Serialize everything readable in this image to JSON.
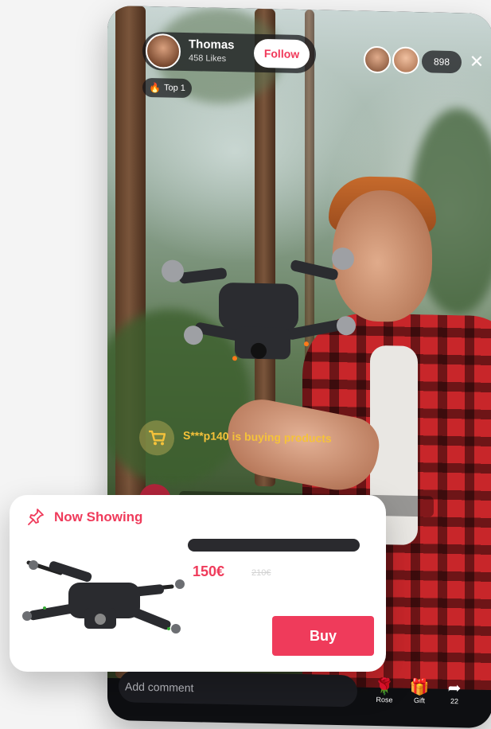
{
  "host": {
    "name": "Thomas",
    "likes": "458 Likes",
    "follow_label": "Follow"
  },
  "badge": {
    "label": "Top 1",
    "icon": "flame-icon"
  },
  "viewers": {
    "count": "898"
  },
  "notification": {
    "text": "S***p140 is buying products",
    "icon": "cart-icon"
  },
  "comment": {
    "placeholder": "Add comment"
  },
  "actions": [
    {
      "label": "Rose",
      "icon": "rose-icon"
    },
    {
      "label": "Gift",
      "icon": "gift-icon"
    },
    {
      "label": "22",
      "icon": "share-icon"
    }
  ],
  "product": {
    "section_label": "Now Showing",
    "price": "150€",
    "old_price": "210€",
    "buy_label": "Buy"
  },
  "colors": {
    "accent": "#EF3B5B",
    "notification": "#F5C23A",
    "dark": "#1C1D22"
  }
}
